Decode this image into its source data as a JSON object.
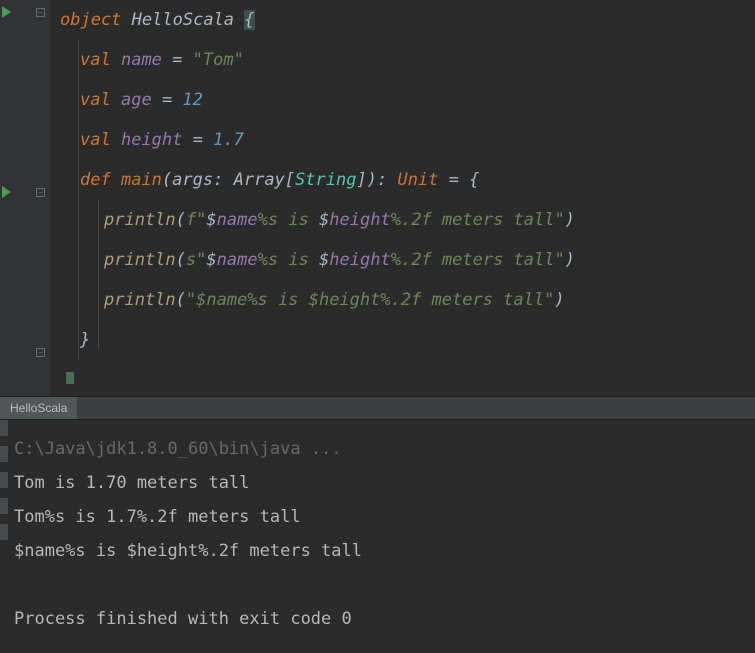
{
  "tab": {
    "title": "HelloScala"
  },
  "code": {
    "line1_kw": "object",
    "line1_name": "HelloScala",
    "line1_brace": "{",
    "val_kw": "val",
    "name_id": "name",
    "name_val": "\"Tom\"",
    "age_id": "age",
    "age_val": "12",
    "height_id": "height",
    "height_val": "1.7",
    "def_kw": "def",
    "main_id": "main",
    "args_id": "args",
    "array_t": "Array",
    "string_t": "String",
    "unit_t": "Unit",
    "println_id": "println",
    "f_prefix": "f",
    "s_prefix": "s",
    "q": "\"",
    "dollar": "$",
    "name_ref": "name",
    "pct_s": "%s",
    "is_txt": " is ",
    "height_ref": "height",
    "pct_2f": "%.2f",
    "tall_txt": " meters tall",
    "plain_body": "\"$name%s is $height%.2f meters tall\"",
    "close_brace": "}",
    "eq": " = ",
    "colon_sp": ": ",
    "lparen": "(",
    "rparen": ")",
    "lbrack": "[",
    "rbrack": "]"
  },
  "console": {
    "cmd": "C:\\Java\\jdk1.8.0_60\\bin\\java ...",
    "out1": "Tom is 1.70 meters tall",
    "out2": "Tom%s is 1.7%.2f meters tall",
    "out3": "$name%s is $height%.2f meters tall",
    "exit": "Process finished with exit code 0"
  }
}
